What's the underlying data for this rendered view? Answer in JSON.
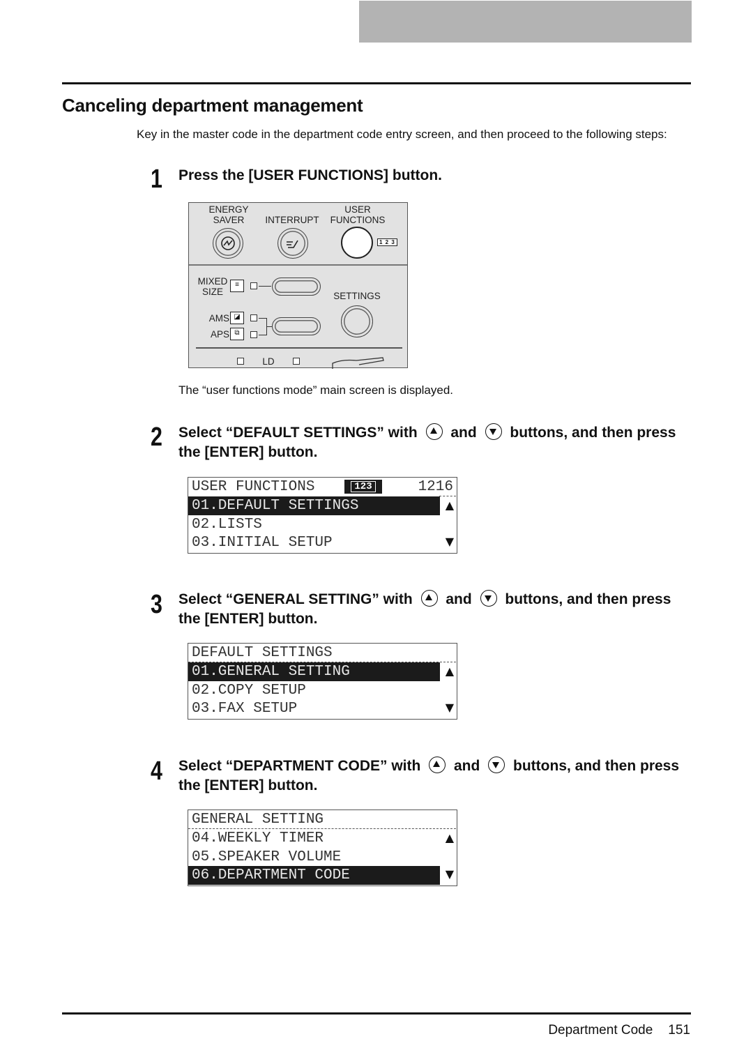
{
  "header": {
    "tab_color": "#b3b3b3"
  },
  "section_title": "Canceling department management",
  "intro": "Key in the master code in the department code entry screen, and then proceed to the following steps:",
  "steps": [
    {
      "number": "1",
      "text": "Press the [USER FUNCTIONS] button."
    },
    {
      "number": "2",
      "text_before": "Select “DEFAULT SETTINGS” with",
      "and": "and",
      "text_after": "buttons, and then press the [ENTER] button."
    },
    {
      "number": "3",
      "text_before": "Select “GENERAL SETTING” with",
      "and": "and",
      "text_after": "buttons, and then press the [ENTER] button."
    },
    {
      "number": "4",
      "text_before": "Select “DEPARTMENT CODE” with",
      "and": "and",
      "text_after": "buttons, and then press the [ENTER] button."
    }
  ],
  "panel": {
    "energy_saver": [
      "ENERGY",
      "SAVER"
    ],
    "interrupt": "INTERRUPT",
    "user_functions": [
      "USER",
      "FUNCTIONS"
    ],
    "indicator_123": "1 2 3",
    "mixed_size": [
      "MIXED",
      "SIZE"
    ],
    "settings": "SETTINGS",
    "ams": "AMS",
    "aps": "APS",
    "ld": "LD"
  },
  "caption_step1": "The “user functions mode” main screen is displayed.",
  "screens": [
    {
      "title": "USER FUNCTIONS",
      "badge": "123",
      "count": "1216",
      "rows": [
        "01.DEFAULT SETTINGS",
        "02.LISTS",
        "03.INITIAL SETUP"
      ],
      "selected_index": 0
    },
    {
      "title": "DEFAULT SETTINGS",
      "rows": [
        "01.GENERAL SETTING",
        "02.COPY SETUP",
        "03.FAX SETUP"
      ],
      "selected_index": 0
    },
    {
      "title": "GENERAL SETTING",
      "rows": [
        "04.WEEKLY TIMER",
        "05.SPEAKER VOLUME",
        "06.DEPARTMENT CODE"
      ],
      "selected_index": 2
    }
  ],
  "arrows": {
    "up": "▲",
    "down": "▼"
  },
  "footer": {
    "section": "Department Code",
    "page": "151"
  }
}
